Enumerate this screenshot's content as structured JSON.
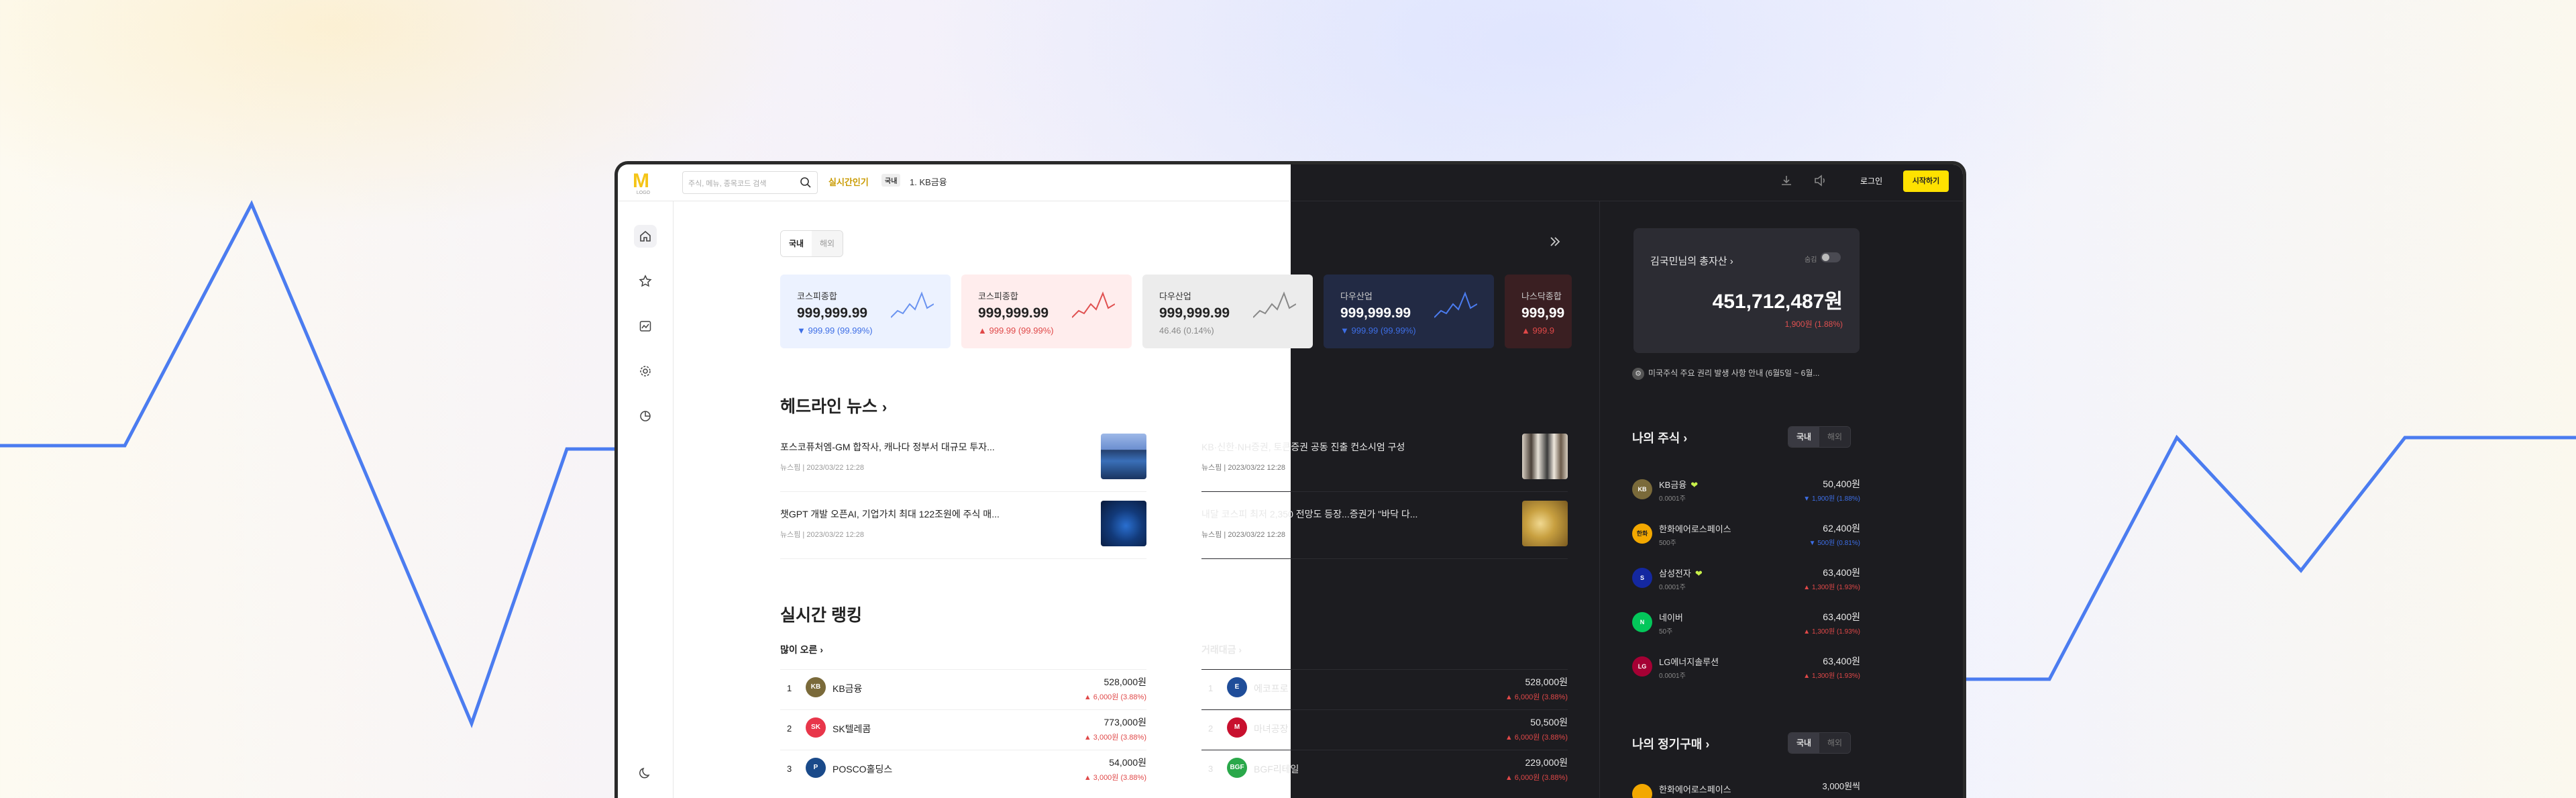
{
  "colors": {
    "accent": "#ffe100",
    "up": "#e04848",
    "down": "#3d6ee6",
    "line": "#4b7cf0"
  },
  "header": {
    "logo_text": "M",
    "logo_sub": "LOGO",
    "search_placeholder": "주식, 메뉴, 종목코드 검색",
    "trend_label": "실시간인기",
    "trend_tag": "국내",
    "trend_item": "1. KB금융",
    "login": "로그인",
    "start": "시작하기"
  },
  "sidebar": [
    "home-icon",
    "star-icon",
    "chart-icon",
    "settings-icon",
    "pie-chart-icon",
    "moon-icon"
  ],
  "market_tabs": [
    "국내",
    "해외"
  ],
  "indices": [
    {
      "name": "코스피종합",
      "value": "999,999.99",
      "change": "▼ 999.99 (99.99%)",
      "dir": "down",
      "bg": "#ecf2ff"
    },
    {
      "name": "코스피종합",
      "value": "999,999.99",
      "change": "▲ 999.99 (99.99%)",
      "dir": "up",
      "bg": "#ffeded"
    },
    {
      "name": "다우산업",
      "value": "999,999.99",
      "change": "46.46 (0.14%)",
      "dir": "flat",
      "bg": "#ececec"
    },
    {
      "name": "다우산업",
      "value": "999,999.99",
      "change": "▼ 999.99 (99.99%)",
      "dir": "down",
      "bg": "#222a44"
    },
    {
      "name": "나스닥종합",
      "value": "999,99",
      "change": "▲ 999.9",
      "dir": "up",
      "bg": "#3a1f22"
    }
  ],
  "headline": {
    "title": "헤드라인 뉴스",
    "items": [
      {
        "title": "포스코퓨처엠-GM 합작사, 캐나다 정부서 대규모 투자...",
        "source": "뉴스핌",
        "date": "2023/03/22 12:28",
        "thumb": "solar"
      },
      {
        "title": "KB·신한·NH증권, 토큰증권 공동 진출 컨소시엄 구성",
        "source": "뉴스핌",
        "date": "2023/03/22 12:28",
        "thumb": "people"
      },
      {
        "title": "챗GPT 개발 오픈AI, 기업가치 최대 122조원에 주식 매...",
        "source": "뉴스핌",
        "date": "2023/03/22 12:28",
        "thumb": "chatgpt"
      },
      {
        "title": "내달 코스피 최저 2,350 전망도 등장...증권가 \"바닥 다...",
        "source": "뉴스핌",
        "date": "2023/03/22 12:28",
        "thumb": "gold"
      }
    ]
  },
  "ranking": {
    "title": "실시간 랭킹",
    "left_title": "많이 오른",
    "right_title": "거래대금",
    "left": [
      {
        "no": "1",
        "name": "KB금융",
        "price": "528,000원",
        "change": "▲ 6,000원 (3.88%)",
        "logo": "KB",
        "color": "#7a6a3a"
      },
      {
        "no": "2",
        "name": "SK텔레콤",
        "price": "773,000원",
        "change": "▲ 3,000원 (3.88%)",
        "logo": "SK",
        "color": "#e8364a"
      },
      {
        "no": "3",
        "name": "POSCO홀딩스",
        "price": "54,000원",
        "change": "▲ 3,000원 (3.88%)",
        "logo": "P",
        "color": "#1a4a8a"
      }
    ],
    "right": [
      {
        "no": "1",
        "name": "에코프로",
        "price": "528,000원",
        "change": "▲ 6,000원 (3.88%)",
        "logo": "E",
        "color": "#1f4d99"
      },
      {
        "no": "2",
        "name": "마녀공장",
        "price": "50,500원",
        "change": "▲ 6,000원 (3.88%)",
        "logo": "M",
        "color": "#c8102e"
      },
      {
        "no": "3",
        "name": "BGF리테일",
        "price": "229,000원",
        "change": "▲ 6,000원 (3.88%)",
        "logo": "BGF",
        "color": "#2aa84a"
      }
    ]
  },
  "asset": {
    "title": "김국민님의 총자산",
    "toggle_label": "숨김",
    "value": "451,712,487원",
    "change": "1,900원 (1.88%)"
  },
  "notice": "미국주식 주요 권리 발생 사항 안내 (6월5일 ~ 6월...",
  "my_stocks": {
    "title": "나의 주식",
    "tabs": [
      "국내",
      "해외"
    ],
    "items": [
      {
        "name": "KB금융",
        "qty": "0.0001주",
        "price": "50,400원",
        "change": "▼ 1,900원 (1.88%)",
        "dir": "down",
        "heart": "❤",
        "logo": "KB",
        "color": "#7a6a3a"
      },
      {
        "name": "한화에어로스페이스",
        "qty": "500주",
        "price": "62,400원",
        "change": "▼ 500원 (0.81%)",
        "dir": "down",
        "heart": "",
        "logo": "한화",
        "color": "#f3a800"
      },
      {
        "name": "삼성전자",
        "qty": "0.0001주",
        "price": "63,400원",
        "change": "▲ 1,300원 (1.93%)",
        "dir": "up",
        "heart": "❤",
        "logo": "S",
        "color": "#1428a0"
      },
      {
        "name": "네이버",
        "qty": "50주",
        "price": "63,400원",
        "change": "▲ 1,300원 (1.93%)",
        "dir": "up",
        "heart": "",
        "logo": "N",
        "color": "#03c75a"
      },
      {
        "name": "LG에너지솔루션",
        "qty": "0.0001주",
        "price": "63,400원",
        "change": "▲ 1,300원 (1.93%)",
        "dir": "up",
        "heart": "",
        "logo": "LG",
        "color": "#a50034"
      }
    ]
  },
  "regular": {
    "title": "나의 정기구매",
    "tabs": [
      "국내",
      "해외"
    ],
    "first_name": "한화에어로스페이스",
    "first_price": "3,000원씩"
  }
}
